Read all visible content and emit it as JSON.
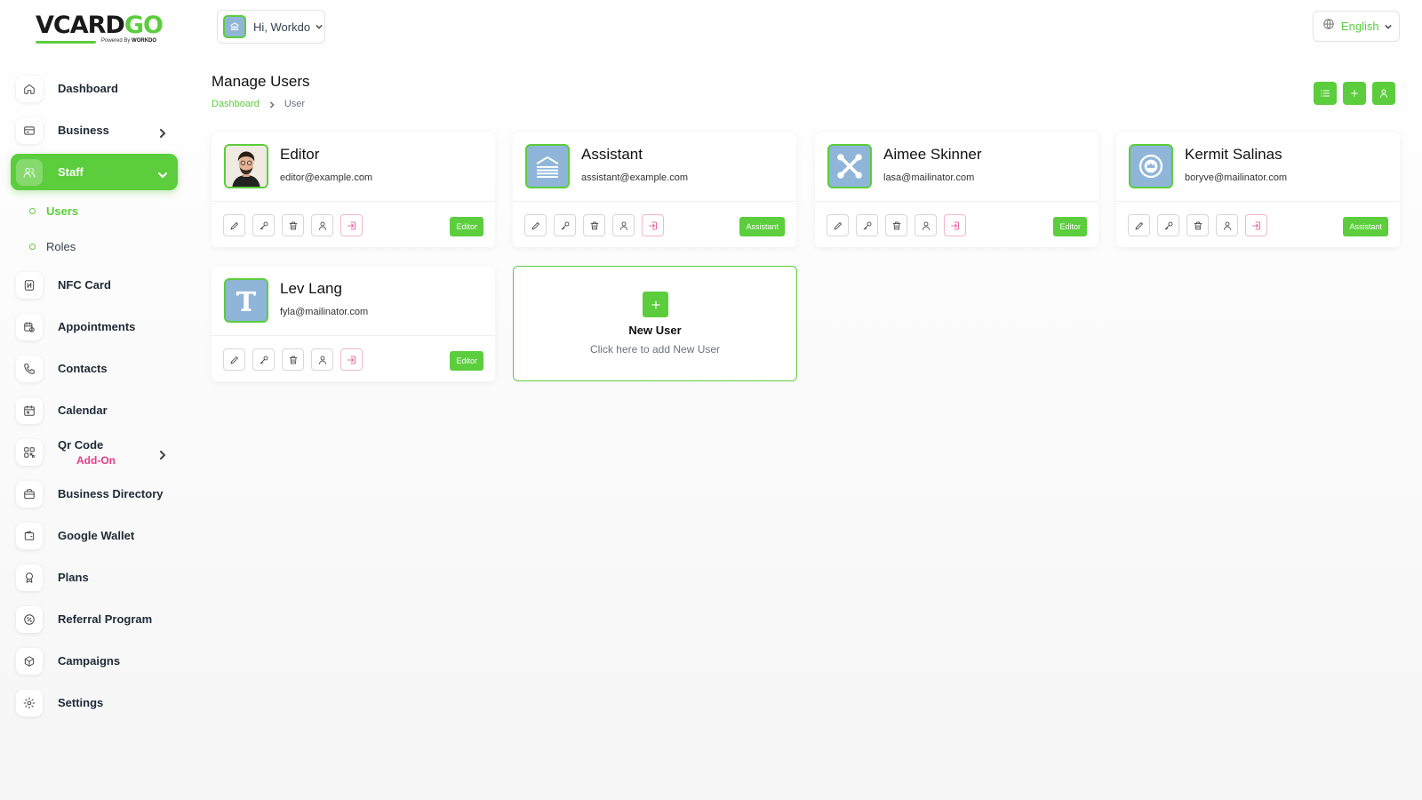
{
  "brand": {
    "logo_main": "VCARD",
    "logo_accent": "GO",
    "logo_sub_prefix": "Powered By",
    "logo_sub_brand": "WORKDO"
  },
  "header": {
    "user_greeting": "Hi, Workdo",
    "language": "English"
  },
  "sidebar": {
    "items": [
      {
        "label": "Dashboard",
        "icon": "home-icon"
      },
      {
        "label": "Business",
        "icon": "business-card-icon"
      },
      {
        "label": "Staff",
        "icon": "users-icon"
      },
      {
        "label": "NFC Card",
        "icon": "nfc-icon"
      },
      {
        "label": "Appointments",
        "icon": "calendar-clock-icon"
      },
      {
        "label": "Contacts",
        "icon": "phone-icon"
      },
      {
        "label": "Calendar",
        "icon": "calendar-icon"
      },
      {
        "label": "Qr Code",
        "icon": "qr-code-icon",
        "badge": "Add-On"
      },
      {
        "label": "Business Directory",
        "icon": "briefcase-icon"
      },
      {
        "label": "Google Wallet",
        "icon": "wallet-icon"
      },
      {
        "label": "Plans",
        "icon": "award-icon"
      },
      {
        "label": "Referral Program",
        "icon": "discount-icon"
      },
      {
        "label": "Campaigns",
        "icon": "box-icon"
      },
      {
        "label": "Settings",
        "icon": "gear-icon"
      }
    ],
    "staff_sub": [
      {
        "label": "Users"
      },
      {
        "label": "Roles"
      }
    ]
  },
  "page": {
    "title": "Manage Users",
    "breadcrumb": {
      "root": "Dashboard",
      "current": "User"
    }
  },
  "users": [
    {
      "name": "Editor",
      "email": "editor@example.com",
      "role": "Editor",
      "avatar": "person-photo"
    },
    {
      "name": "Assistant",
      "email": "assistant@example.com",
      "role": "Assistant",
      "avatar": "building-logo"
    },
    {
      "name": "Aimee Skinner",
      "email": "lasa@mailinator.com",
      "role": "Editor",
      "avatar": "joomla-logo"
    },
    {
      "name": "Kermit Salinas",
      "email": "boryve@mailinator.com",
      "role": "Assistant",
      "avatar": "crown-seal-logo"
    },
    {
      "name": "Lev Lang",
      "email": "fyla@mailinator.com",
      "role": "Editor",
      "avatar": "t-logo"
    }
  ],
  "new_user": {
    "title": "New User",
    "subtitle": "Click here to add New User"
  },
  "colors": {
    "accent": "#5ccd3d",
    "addon": "#e63c8a",
    "avatar_bg": "#8fb5d8"
  }
}
